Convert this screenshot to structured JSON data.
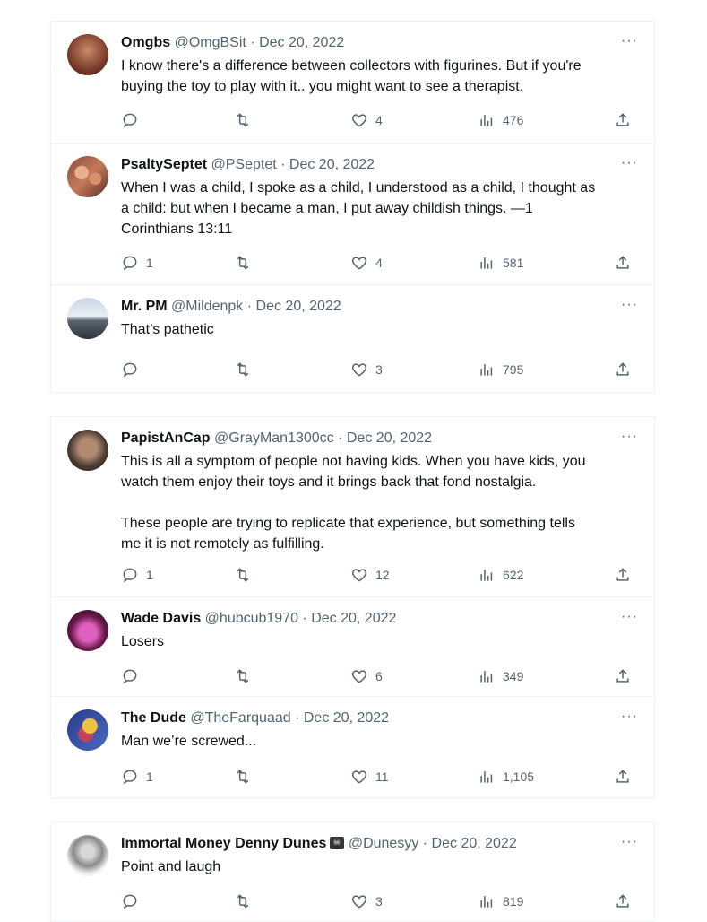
{
  "cards": [
    {
      "tweets": [
        {
          "name": "Omgbs",
          "handle": "@OmgBSit",
          "date": "Dec 20, 2022",
          "text": "I know there's a difference between collectors with figurines. But if you're\nbuying the toy to play with it.. you might want to see a therapist.",
          "replies": "",
          "likes": "4",
          "views": "476"
        },
        {
          "name": "PsaltySeptet",
          "handle": "@PSeptet",
          "date": "Dec 20, 2022",
          "text": "When I was a child, I spoke as a child, I understood as a child, I thought as\na child: but when I became a man, I put away childish things. —1\nCorinthians 13:11",
          "replies": "1",
          "likes": "4",
          "views": "581"
        },
        {
          "name": "Mr. PM",
          "handle": "@Mildenpk",
          "date": "Dec 20, 2022",
          "text": "That’s pathetic",
          "replies": "",
          "likes": "3",
          "views": "795"
        }
      ]
    },
    {
      "tweets": [
        {
          "name": "PapistAnCap",
          "handle": "@GrayMan1300cc",
          "date": "Dec 20, 2022",
          "text": "This is all a symptom of people not having kids. When you have kids, you\nwatch them enjoy their toys and it brings back that fond nostalgia.\n\nThese people are trying to replicate that experience, but something tells\nme it is not remotely as fulfilling.",
          "replies": "1",
          "likes": "12",
          "views": "622"
        },
        {
          "name": "Wade Davis",
          "handle": "@hubcub1970",
          "date": "Dec 20, 2022",
          "text": "Losers",
          "replies": "",
          "likes": "6",
          "views": "349"
        },
        {
          "name": "The Dude",
          "handle": "@TheFarquaad",
          "date": "Dec 20, 2022",
          "text": "Man we’re screwed...",
          "replies": "1",
          "likes": "11",
          "views": "1,105"
        }
      ]
    },
    {
      "tweets": [
        {
          "name": "Immortal Money Denny Dunes",
          "handle": "@Dunesyy",
          "date": "Dec 20, 2022",
          "text": "Point and laugh",
          "replies": "",
          "likes": "3",
          "views": "819"
        }
      ]
    }
  ],
  "ui": {
    "more": "···",
    "sep": " · "
  },
  "colors": {
    "text": "#0f1419",
    "secondary": "#536471",
    "border": "#eff3f4"
  },
  "icons": {
    "reply": "reply-icon",
    "retweet": "retweet-icon",
    "like": "heart-icon",
    "views": "analytics-icon",
    "share": "share-icon",
    "more": "more-icon"
  }
}
